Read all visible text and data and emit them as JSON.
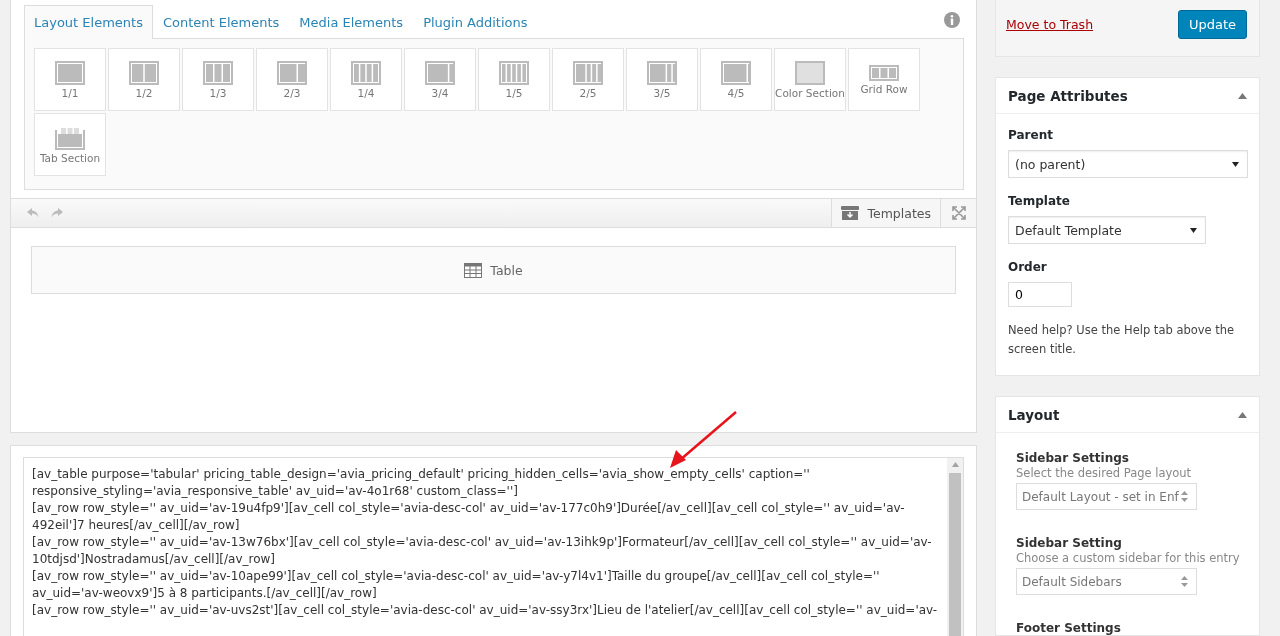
{
  "builder": {
    "tabs": [
      {
        "label": "Layout Elements",
        "selected": true
      },
      {
        "label": "Content Elements",
        "selected": false
      },
      {
        "label": "Media Elements",
        "selected": false
      },
      {
        "label": "Plugin Additions",
        "selected": false
      }
    ],
    "elements": [
      "1/1",
      "1/2",
      "1/3",
      "2/3",
      "1/4",
      "3/4",
      "1/5",
      "2/5",
      "3/5",
      "4/5",
      "Color Section",
      "Grid Row",
      "Tab Section"
    ],
    "toolbar": {
      "templates_label": "Templates"
    },
    "canvas_items": [
      {
        "label": "Table"
      }
    ]
  },
  "shortcode_editor": {
    "lines": [
      "[av_table purpose='tabular' pricing_table_design='avia_pricing_default' pricing_hidden_cells='avia_show_empty_cells' caption='' responsive_styling='avia_responsive_table' av_uid='av-4o1r68' custom_class='']",
      "[av_row row_style='' av_uid='av-19u4fp9'][av_cell col_style='avia-desc-col' av_uid='av-177c0h9']Durée[/av_cell][av_cell col_style='' av_uid='av-492eil']7 heures[/av_cell][/av_row]",
      "[av_row row_style='' av_uid='av-13w76bx'][av_cell col_style='avia-desc-col' av_uid='av-13ihk9p']Formateur[/av_cell][av_cell col_style='' av_uid='av-10tdjsd']Nostradamus[/av_cell][/av_row]",
      "[av_row row_style='' av_uid='av-10ape99'][av_cell col_style='avia-desc-col' av_uid='av-y7l4v1']Taille du groupe[/av_cell][av_cell col_style='' av_uid='av-weovx9']5 à 8 participants.[/av_cell][/av_row]",
      "[av_row row_style='' av_uid='av-uvs2st'][av_cell col_style='avia-desc-col' av_uid='av-ssy3rx']Lieu de l'atelier[/av_cell][av_cell col_style='' av_uid='av-"
    ]
  },
  "publish": {
    "trash_link": "Move to Trash",
    "update_button": "Update"
  },
  "page_attributes": {
    "title": "Page Attributes",
    "expanded": true,
    "parent_label": "Parent",
    "parent_value": "(no parent)",
    "template_label": "Template",
    "template_value": "Default Template",
    "order_label": "Order",
    "order_value": "0",
    "help": "Need help? Use the Help tab above the screen title."
  },
  "layout": {
    "title": "Layout",
    "expanded": true,
    "settings": [
      {
        "label": "Sidebar Settings",
        "hint": "Select the desired Page layout",
        "value": "Default Layout - set in Enf"
      },
      {
        "label": "Sidebar Setting",
        "hint": "Choose a custom sidebar for this entry",
        "value": "Default Sidebars"
      },
      {
        "label": "Footer Settings"
      }
    ]
  }
}
